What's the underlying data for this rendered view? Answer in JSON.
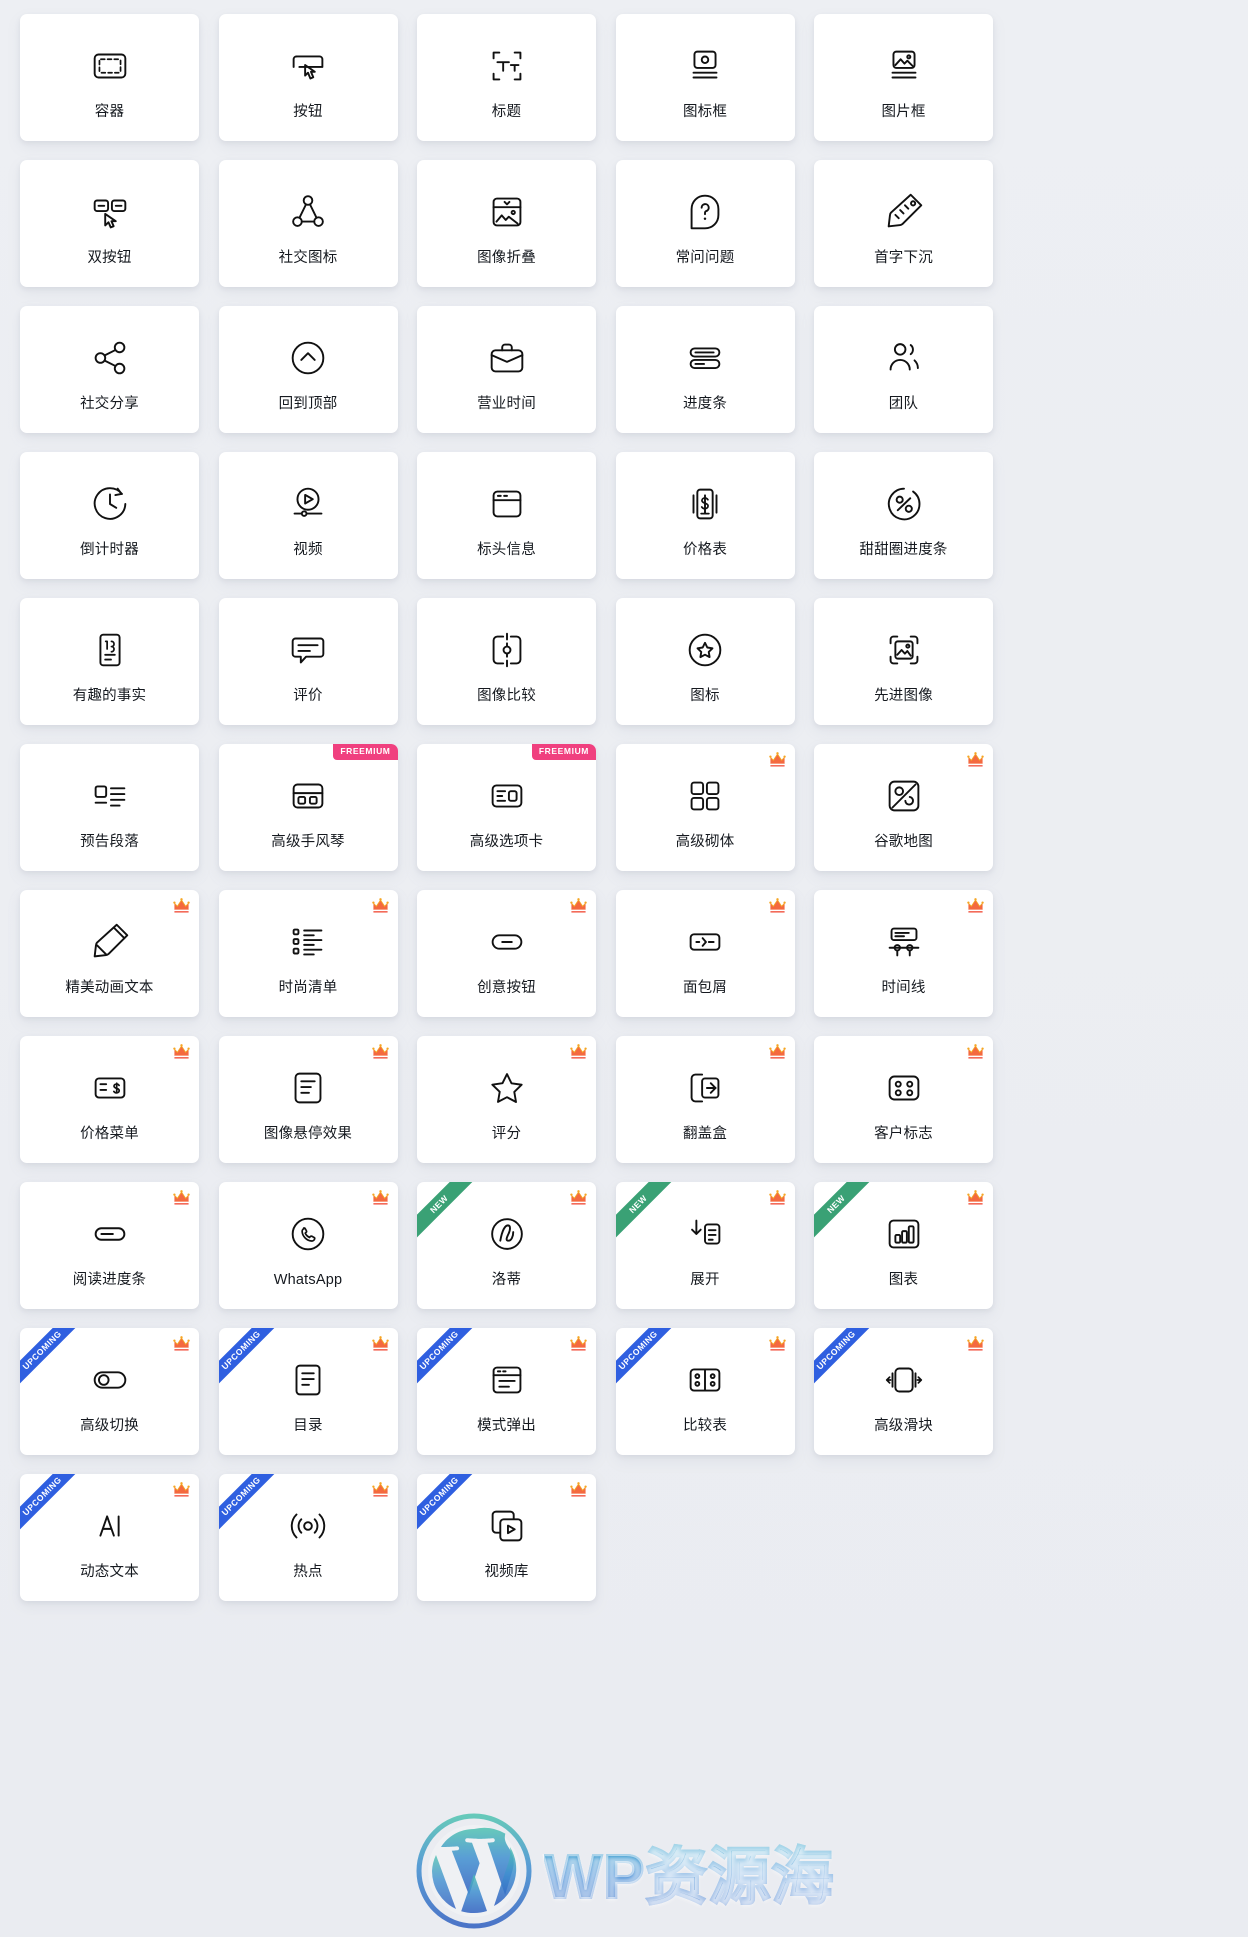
{
  "page": {
    "background_color": "#eceef2",
    "card_color": "#ffffff",
    "label_color": "#15191f",
    "freemium_color": "#f0407f",
    "crown_color": "#f4693f",
    "new_ribbon_color": "#3aa175",
    "upcoming_ribbon_color": "#2f5fe0"
  },
  "badges": {
    "freemium_label": "FREEMIUM",
    "new_label": "NEW",
    "upcoming_label": "UPCOMING",
    "crown_label": "PRO"
  },
  "watermark": {
    "text": "WP资源海",
    "logo_letter": "W"
  },
  "widgets": [
    {
      "label": "容器",
      "icon": "container-icon",
      "badge": null
    },
    {
      "label": "按钮",
      "icon": "button-click-icon",
      "badge": null
    },
    {
      "label": "标题",
      "icon": "heading-icon",
      "badge": null
    },
    {
      "label": "图标框",
      "icon": "icon-box-icon",
      "badge": null
    },
    {
      "label": "图片框",
      "icon": "image-box-icon",
      "badge": null
    },
    {
      "label": "双按钮",
      "icon": "dual-button-icon",
      "badge": null
    },
    {
      "label": "社交图标",
      "icon": "social-icons-icon",
      "badge": null
    },
    {
      "label": "图像折叠",
      "icon": "image-accordion-icon",
      "badge": null
    },
    {
      "label": "常问问题",
      "icon": "faq-icon",
      "badge": null
    },
    {
      "label": "首字下沉",
      "icon": "drop-cap-icon",
      "badge": null
    },
    {
      "label": "社交分享",
      "icon": "social-share-icon",
      "badge": null
    },
    {
      "label": "回到顶部",
      "icon": "back-to-top-icon",
      "badge": null
    },
    {
      "label": "营业时间",
      "icon": "business-hours-icon",
      "badge": null
    },
    {
      "label": "进度条",
      "icon": "progress-bar-icon",
      "badge": null
    },
    {
      "label": "团队",
      "icon": "team-icon",
      "badge": null
    },
    {
      "label": "倒计时器",
      "icon": "countdown-timer-icon",
      "badge": null
    },
    {
      "label": "视频",
      "icon": "video-icon",
      "badge": null
    },
    {
      "label": "标头信息",
      "icon": "header-info-icon",
      "badge": null
    },
    {
      "label": "价格表",
      "icon": "price-table-icon",
      "badge": null
    },
    {
      "label": "甜甜圈进度条",
      "icon": "donut-progress-icon",
      "badge": null
    },
    {
      "label": "有趣的事实",
      "icon": "fun-fact-icon",
      "badge": null
    },
    {
      "label": "评价",
      "icon": "testimonial-icon",
      "badge": null
    },
    {
      "label": "图像比较",
      "icon": "image-compare-icon",
      "badge": null
    },
    {
      "label": "图标",
      "icon": "star-badge-icon",
      "badge": null
    },
    {
      "label": "先进图像",
      "icon": "advanced-image-icon",
      "badge": null
    },
    {
      "label": "预告段落",
      "icon": "teaser-paragraph-icon",
      "badge": null
    },
    {
      "label": "高级手风琴",
      "icon": "advanced-accordion-icon",
      "badge": "freemium"
    },
    {
      "label": "高级选项卡",
      "icon": "advanced-tabs-icon",
      "badge": "freemium"
    },
    {
      "label": "高级砌体",
      "icon": "advanced-masonry-icon",
      "badge": "crown"
    },
    {
      "label": "谷歌地图",
      "icon": "google-map-icon",
      "badge": "crown"
    },
    {
      "label": "精美动画文本",
      "icon": "animated-text-icon",
      "badge": "crown"
    },
    {
      "label": "时尚清单",
      "icon": "stylish-list-icon",
      "badge": "crown"
    },
    {
      "label": "创意按钮",
      "icon": "creative-button-icon",
      "badge": "crown"
    },
    {
      "label": "面包屑",
      "icon": "breadcrumb-icon",
      "badge": "crown"
    },
    {
      "label": "时间线",
      "icon": "timeline-icon",
      "badge": "crown"
    },
    {
      "label": "价格菜单",
      "icon": "price-menu-icon",
      "badge": "crown"
    },
    {
      "label": "图像悬停效果",
      "icon": "image-hover-icon",
      "badge": "crown"
    },
    {
      "label": "评分",
      "icon": "rating-star-icon",
      "badge": "crown"
    },
    {
      "label": "翻盖盒",
      "icon": "flip-box-icon",
      "badge": "crown"
    },
    {
      "label": "客户标志",
      "icon": "client-logo-icon",
      "badge": "crown"
    },
    {
      "label": "阅读进度条",
      "icon": "reading-progress-icon",
      "badge": "crown"
    },
    {
      "label": "WhatsApp",
      "icon": "whatsapp-icon",
      "badge": "crown"
    },
    {
      "label": "洛蒂",
      "icon": "lottie-icon",
      "badge": "crown",
      "ribbon": "new"
    },
    {
      "label": "展开",
      "icon": "expand-icon",
      "badge": "crown",
      "ribbon": "new"
    },
    {
      "label": "图表",
      "icon": "chart-icon",
      "badge": "crown",
      "ribbon": "new"
    },
    {
      "label": "高级切换",
      "icon": "advanced-toggle-icon",
      "badge": "crown",
      "ribbon": "upcoming"
    },
    {
      "label": "目录",
      "icon": "table-of-contents-icon",
      "badge": "crown",
      "ribbon": "upcoming"
    },
    {
      "label": "模式弹出",
      "icon": "modal-popup-icon",
      "badge": "crown",
      "ribbon": "upcoming"
    },
    {
      "label": "比较表",
      "icon": "comparison-table-icon",
      "badge": "crown",
      "ribbon": "upcoming"
    },
    {
      "label": "高级滑块",
      "icon": "advanced-slider-icon",
      "badge": "crown",
      "ribbon": "upcoming"
    },
    {
      "label": "动态文本",
      "icon": "dynamic-text-icon",
      "badge": "crown",
      "ribbon": "upcoming"
    },
    {
      "label": "热点",
      "icon": "hotspot-icon",
      "badge": "crown",
      "ribbon": "upcoming"
    },
    {
      "label": "视频库",
      "icon": "video-gallery-icon",
      "badge": "crown",
      "ribbon": "upcoming"
    }
  ]
}
